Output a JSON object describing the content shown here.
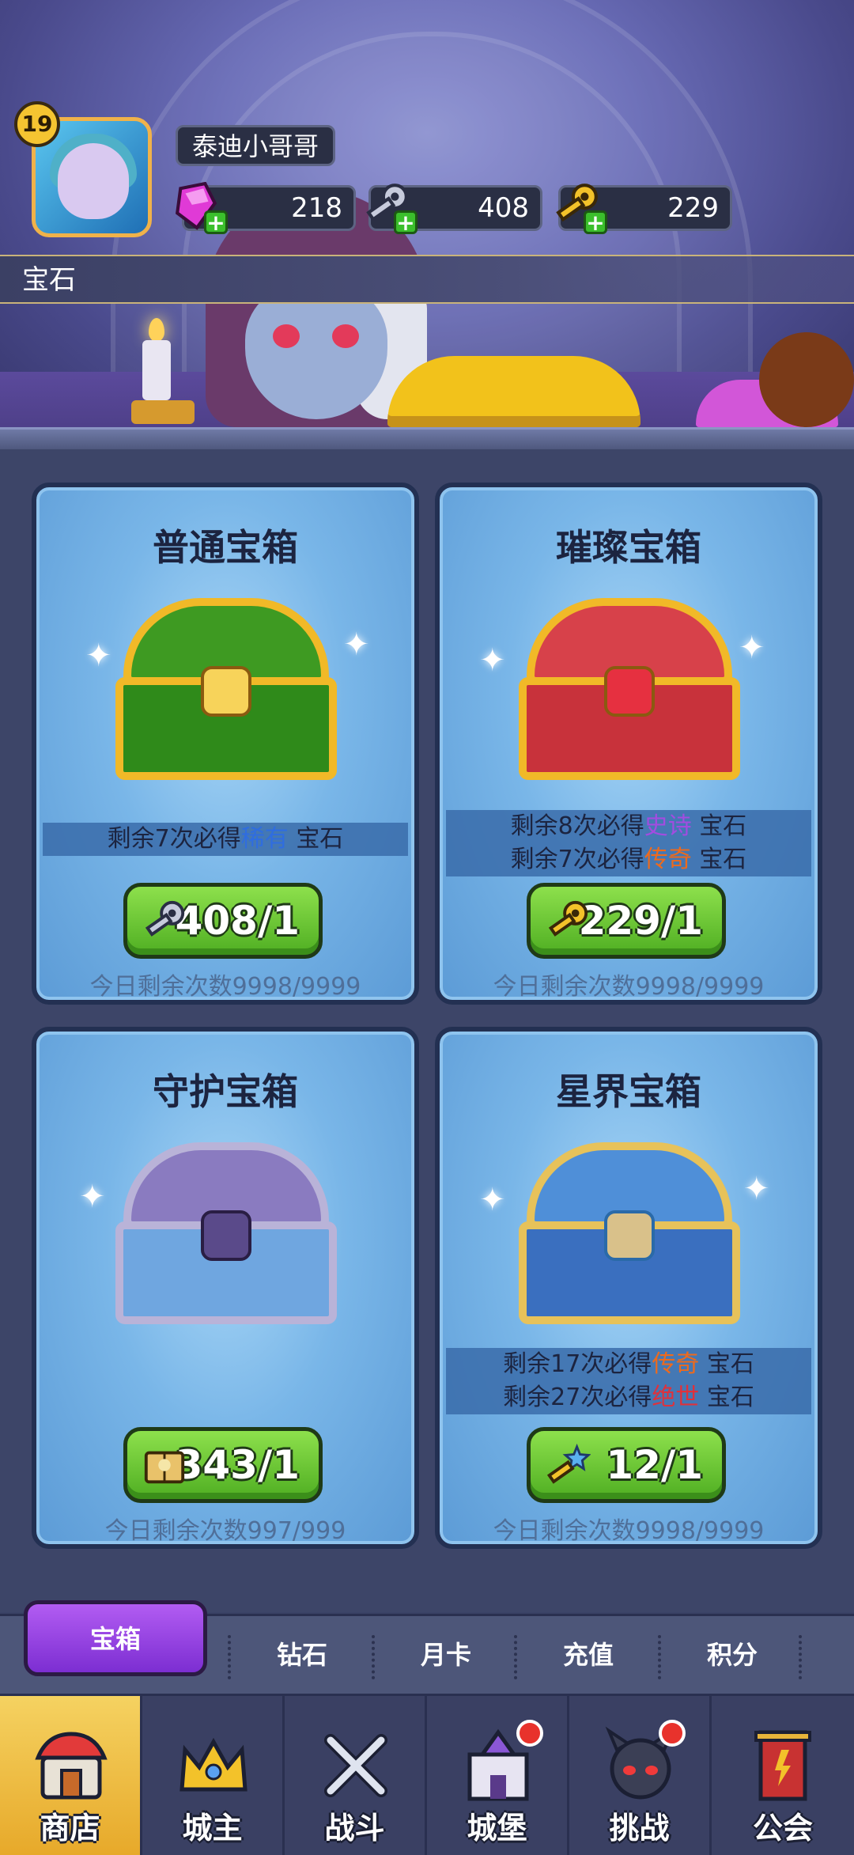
{
  "player": {
    "level": "19",
    "name": "泰迪小哥哥"
  },
  "currencies": {
    "gems": "218",
    "silver_keys": "408",
    "gold_keys": "229"
  },
  "section_title": "宝石",
  "chests": [
    {
      "title": "普通宝箱",
      "info": [
        {
          "prefix": "剩余7次必得",
          "rarity": "稀有",
          "suffix": "宝石"
        }
      ],
      "price": "408/1",
      "daily": "今日剩余次数9998/9999"
    },
    {
      "title": "璀璨宝箱",
      "info": [
        {
          "prefix": "剩余8次必得",
          "rarity": "史诗",
          "suffix": "宝石"
        },
        {
          "prefix": "剩余7次必得",
          "rarity": "传奇",
          "suffix": "宝石"
        }
      ],
      "price": "229/1",
      "daily": "今日剩余次数9998/9999"
    },
    {
      "title": "守护宝箱",
      "info": [],
      "price": "343/1",
      "daily": "今日剩余次数997/999"
    },
    {
      "title": "星界宝箱",
      "info": [
        {
          "prefix": "剩余17次必得",
          "rarity": "传奇",
          "suffix": "宝石"
        },
        {
          "prefix": "剩余27次必得",
          "rarity": "绝世",
          "suffix": "宝石"
        }
      ],
      "price": "12/1",
      "daily": "今日剩余次数9998/9999"
    }
  ],
  "tabs": [
    "宝箱",
    "钻石",
    "月卡",
    "充值",
    "积分"
  ],
  "nav": [
    "商店",
    "城主",
    "战斗",
    "城堡",
    "挑战",
    "公会"
  ],
  "colors": {
    "accent_green": "#4fae22",
    "accent_purple": "#9b46e6",
    "nav_active": "#e7a92a",
    "rare": "#2f6de0",
    "epic": "#a24ce0",
    "legend": "#ee6a1c",
    "peerless": "#e0313b"
  },
  "icons": {
    "gems": "pink-gem-icon",
    "silver_keys": "silver-key-icon",
    "gold_keys": "gold-key-icon",
    "guardian_cost": "spellbook-icon",
    "astral_cost": "star-key-icon"
  }
}
